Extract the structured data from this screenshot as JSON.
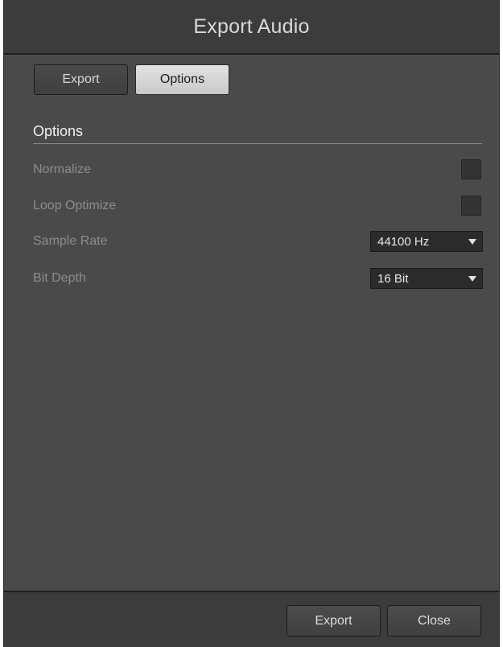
{
  "window": {
    "title": "Export Audio"
  },
  "tabs": [
    {
      "label": "Export",
      "active": false
    },
    {
      "label": "Options",
      "active": true
    }
  ],
  "options": {
    "section_title": "Options",
    "normalize": {
      "label": "Normalize",
      "checked": false
    },
    "loop_optimize": {
      "label": "Loop Optimize",
      "checked": false
    },
    "sample_rate": {
      "label": "Sample Rate",
      "value": "44100 Hz"
    },
    "bit_depth": {
      "label": "Bit Depth",
      "value": "16 Bit"
    }
  },
  "footer": {
    "export_label": "Export",
    "close_label": "Close"
  },
  "colors": {
    "dialog_bg": "#4a4a4a",
    "header_bg": "#3c3c3c",
    "active_tab_bg": "#d6d6d6",
    "label_text": "#8c8c8c"
  },
  "icons": {
    "dropdown": "triangle-down-icon"
  }
}
